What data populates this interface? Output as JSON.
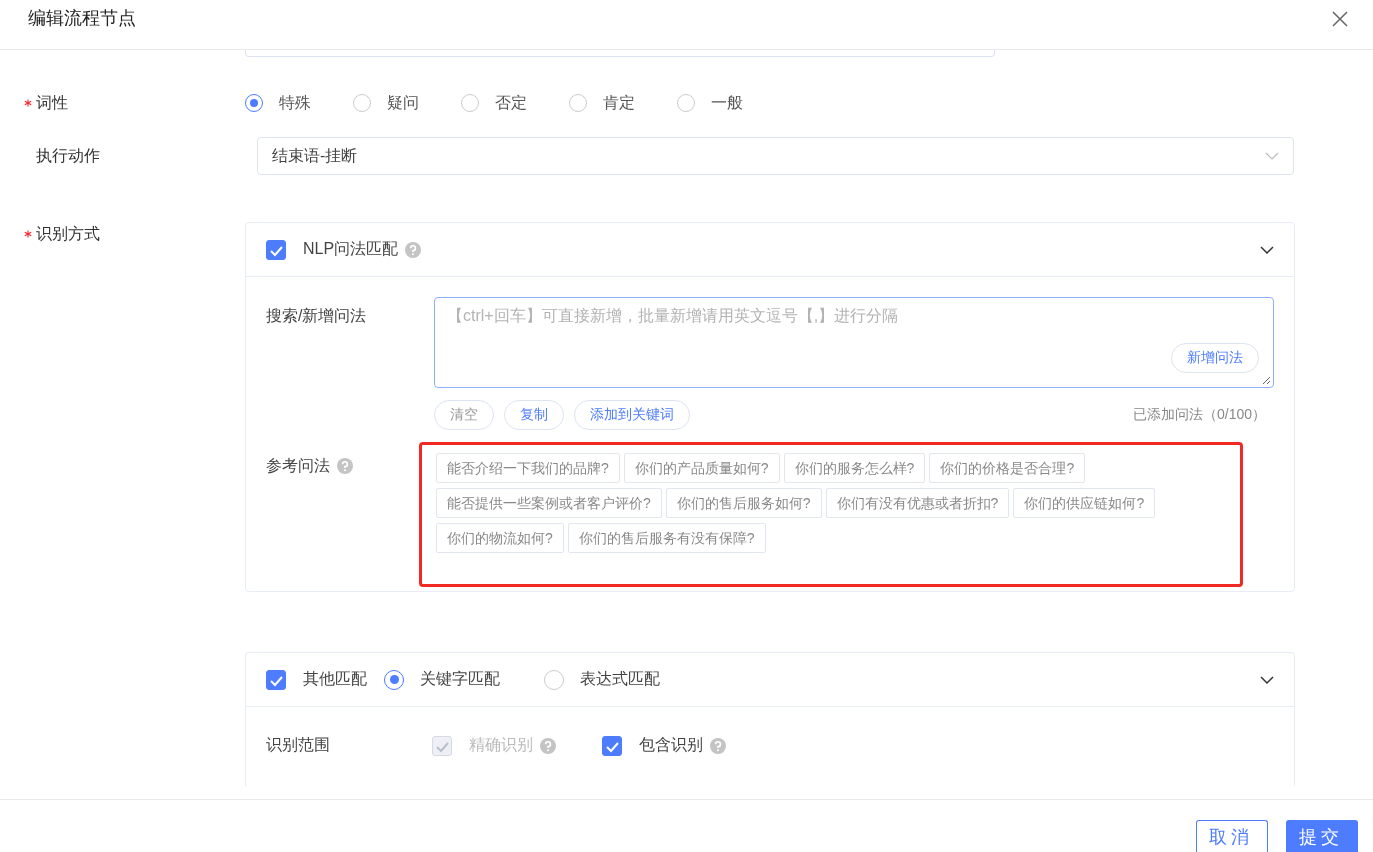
{
  "dialog": {
    "title": "编辑流程节点"
  },
  "form": {
    "part_of_speech": {
      "label": "词性",
      "required": true,
      "options": [
        {
          "label": "特殊",
          "selected": true
        },
        {
          "label": "疑问",
          "selected": false
        },
        {
          "label": "否定",
          "selected": false
        },
        {
          "label": "肯定",
          "selected": false
        },
        {
          "label": "一般",
          "selected": false
        }
      ]
    },
    "action": {
      "label": "执行动作",
      "required": false,
      "value": "结束语-挂断"
    },
    "recognition": {
      "label": "识别方式",
      "required": true,
      "nlp_panel": {
        "title": "NLP问法匹配",
        "checked": true,
        "search_label": "搜索/新增问法",
        "placeholder": "【ctrl+回车】可直接新增，批量新增请用英文逗号【,】进行分隔",
        "add_button": "新增问法",
        "actions": [
          {
            "label": "清空",
            "disabled": true
          },
          {
            "label": "复制",
            "disabled": false
          },
          {
            "label": "添加到关键词",
            "disabled": false
          }
        ],
        "count": "已添加问法（0/100）",
        "reference_label": "参考问法",
        "reference_highlighted": true,
        "reference_phrases": [
          "能否介绍一下我们的品牌?",
          "你们的产品质量如何?",
          "你们的服务怎么样?",
          "你们的价格是否合理?",
          "能否提供一些案例或者客户评价?",
          "你们的售后服务如何?",
          "你们有没有优惠或者折扣?",
          "你们的供应链如何?",
          "你们的物流如何?",
          "你们的售后服务有没有保障?"
        ]
      },
      "other_panel": {
        "title": "其他匹配",
        "checked": true,
        "modes": [
          {
            "label": "关键字匹配",
            "selected": true
          },
          {
            "label": "表达式匹配",
            "selected": false
          }
        ],
        "scope_label": "识别范围",
        "scopes": [
          {
            "label": "精确识别",
            "checked": true,
            "disabled": true
          },
          {
            "label": "包含识别",
            "checked": true,
            "disabled": false
          }
        ]
      }
    }
  },
  "footer": {
    "buttons": [
      {
        "label": "取消",
        "kind": "secondary"
      },
      {
        "label": "提交",
        "kind": "primary"
      }
    ]
  }
}
